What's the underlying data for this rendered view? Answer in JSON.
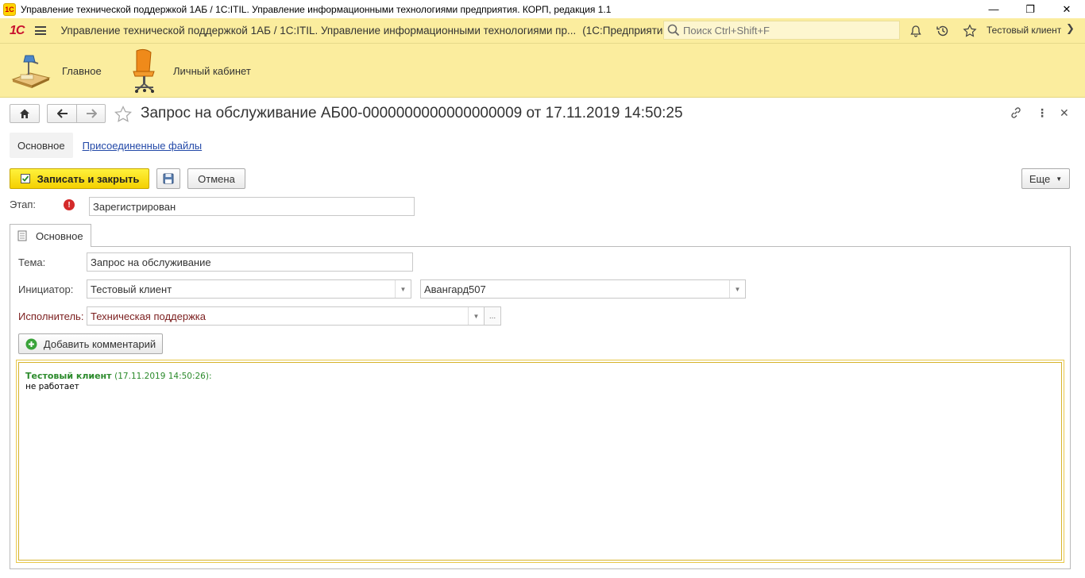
{
  "window": {
    "title": "Управление технической поддержкой 1АБ / 1С:ITIL. Управление информационными технологиями предприятия. КОРП, редакция 1.1",
    "logo_icon": "1c-logo-icon",
    "buttons": {
      "minimize": "—",
      "restore": "❐",
      "close": "✕"
    }
  },
  "topbar": {
    "logo": "1С",
    "app_title": "Управление технической поддержкой 1АБ / 1С:ITIL. Управление информационными технологиями пр...",
    "mode": "(1С:Предприятие)",
    "search_placeholder": "Поиск Ctrl+Shift+F",
    "user": "Тестовый клиент"
  },
  "sections": [
    {
      "label": "Главное",
      "icon": "desk-lamp-icon"
    },
    {
      "label": "Личный кабинет",
      "icon": "office-chair-icon"
    }
  ],
  "form": {
    "title": "Запрос на обслуживание АБ00-0000000000000000009 от 17.11.2019 14:50:25",
    "tabs": {
      "main": "Основное",
      "files": "Присоединенные файлы"
    },
    "commands": {
      "save_close": "Записать и закрыть",
      "cancel": "Отмена",
      "more": "Еще"
    },
    "stage": {
      "label": "Этап:",
      "value": "Зарегистрирован"
    },
    "inner_tab": "Основное",
    "theme": {
      "label": "Тема:",
      "value": "Запрос на обслуживание"
    },
    "initiator": {
      "label": "Инициатор:",
      "value": "Тестовый клиент",
      "org": "Авангард507"
    },
    "executor": {
      "label": "Исполнитель:",
      "value": "Техническая поддержка"
    },
    "add_comment": "Добавить комментарий",
    "comment": {
      "author": "Тестовый клиент",
      "date": "(17.11.2019 14:50:26):",
      "text": "не работает"
    }
  },
  "colors": {
    "accent": "#fbed9e",
    "primary_button": "#f4d000",
    "link": "#2349a8",
    "comment_author": "#2b8a2b"
  }
}
